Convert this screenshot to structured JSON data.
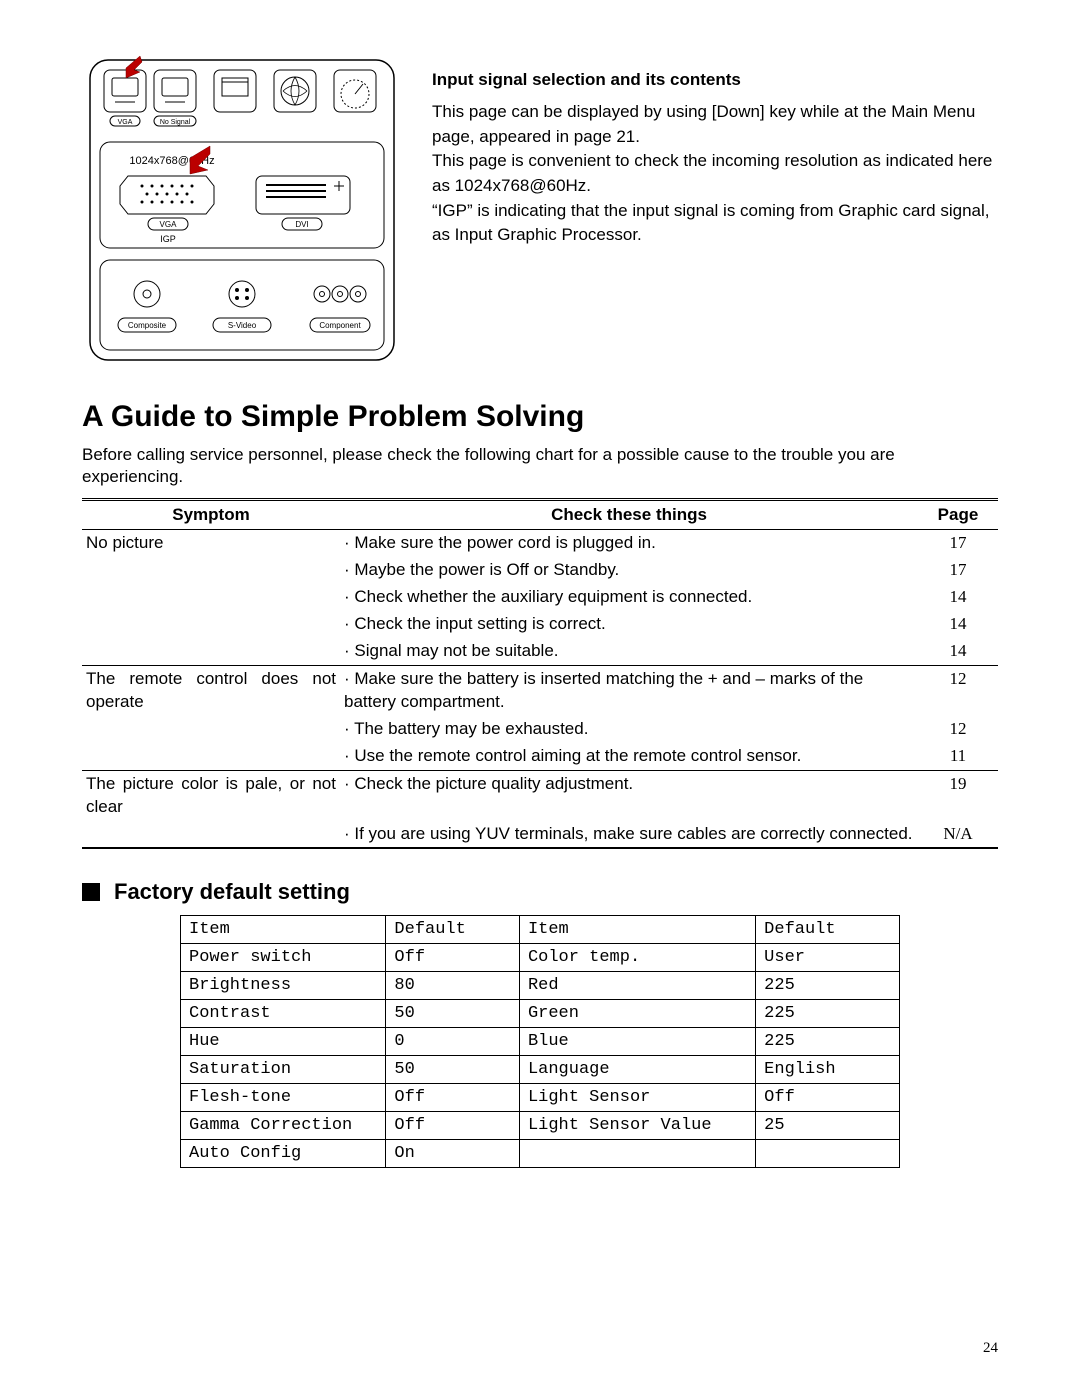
{
  "diagram": {
    "resolution_label": "1024x768@60Hz",
    "icons": [
      {
        "label": "VGA"
      },
      {
        "label": "No Signal"
      },
      {
        "label": ""
      },
      {
        "label": ""
      },
      {
        "label": ""
      }
    ],
    "ports": [
      {
        "label": "VGA",
        "sub": "IGP"
      },
      {
        "label": "DVI",
        "sub": ""
      }
    ],
    "inputs": [
      {
        "label": "Composite"
      },
      {
        "label": "S-Video"
      },
      {
        "label": "Component"
      }
    ]
  },
  "side": {
    "header": "Input signal selection and its contents",
    "para1": "This page can be displayed by using [Down] key while at the Main Menu page, appeared in page 21.",
    "para2": "This page is convenient to check the incoming resolution as indicated here as 1024x768@60Hz.",
    "para3": "“IGP” is indicating that the input signal is coming from Graphic card signal, as Input Graphic Processor."
  },
  "title": "A Guide to Simple Problem Solving",
  "intro": "Before calling service personnel, please check the following chart for a possible cause to the trouble you are experiencing.",
  "trouble": {
    "head": {
      "symptom": "Symptom",
      "check": "Check these things",
      "page": "Page"
    },
    "groups": [
      {
        "symptom": "No picture",
        "rows": [
          {
            "check": "· Make sure the power cord is plugged in.",
            "page": "17"
          },
          {
            "check": "· Maybe the power is Off or Standby.",
            "page": "17"
          },
          {
            "check": "· Check whether the auxiliary equipment is connected.",
            "page": "14"
          },
          {
            "check": "· Check the input setting is correct.",
            "page": "14"
          },
          {
            "check": "· Signal may not be suitable.",
            "page": "14"
          }
        ]
      },
      {
        "symptom": "The remote control does not operate",
        "rows": [
          {
            "check": "· Make sure the battery is inserted matching the + and – marks of the battery compartment.",
            "page": "12"
          },
          {
            "check": "· The battery may be exhausted.",
            "page": "12"
          },
          {
            "check": "· Use the remote control aiming at the remote control sensor.",
            "page": "11"
          }
        ]
      },
      {
        "symptom": "The picture color is pale, or not clear",
        "rows": [
          {
            "check": "· Check the picture quality adjustment.",
            "page": "19"
          },
          {
            "check": "· If you are using YUV terminals, make sure cables are correctly connected.",
            "page": "N/A"
          }
        ]
      }
    ]
  },
  "defaults": {
    "heading": "Factory default setting",
    "head": {
      "item": "Item",
      "default": "Default"
    },
    "rows": [
      {
        "lItem": "Power switch",
        "lDef": "Off",
        "rItem": "Color temp.",
        "rDef": "User"
      },
      {
        "lItem": "Brightness",
        "lDef": "80",
        "rItem": "Red",
        "rDef": "225"
      },
      {
        "lItem": "Contrast",
        "lDef": "50",
        "rItem": "Green",
        "rDef": "225"
      },
      {
        "lItem": "Hue",
        "lDef": "0",
        "rItem": "Blue",
        "rDef": "225"
      },
      {
        "lItem": "Saturation",
        "lDef": "50",
        "rItem": "Language",
        "rDef": "English"
      },
      {
        "lItem": "Flesh-tone",
        "lDef": "Off",
        "rItem": "Light Sensor",
        "rDef": "Off"
      },
      {
        "lItem": "Gamma Correction",
        "lDef": "Off",
        "rItem": "Light Sensor Value",
        "rDef": "25"
      },
      {
        "lItem": "Auto Config",
        "lDef": "On",
        "rItem": "",
        "rDef": ""
      }
    ]
  },
  "page_number": "24"
}
